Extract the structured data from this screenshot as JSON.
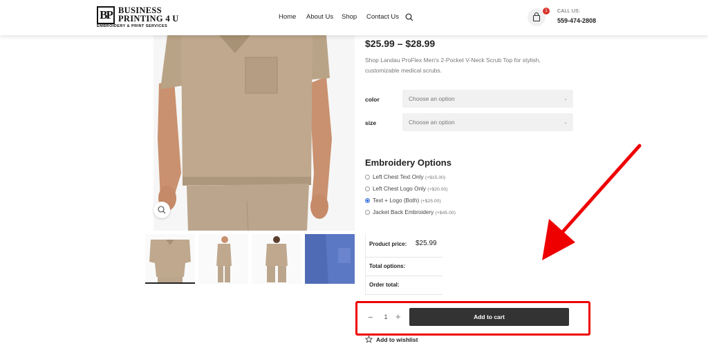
{
  "header": {
    "logo_mark": "BP",
    "logo_line1": "BUSINESS",
    "logo_line2": "PRINTING 4 U",
    "logo_tagline": "EMBROIDERY & PRINT SERVICES",
    "nav": [
      {
        "label": "Home"
      },
      {
        "label": "About Us"
      },
      {
        "label": "Shop"
      },
      {
        "label": "Contact Us"
      }
    ],
    "cart_count": "1",
    "call_label": "CALL US:",
    "call_number": "559-474-2808"
  },
  "product": {
    "price_range": "$25.99 – $28.99",
    "description": "Shop Landau ProFlex Men's 2-Pocket V-Neck Scrub Top for stylish, customizable medical scrubs.",
    "attributes": [
      {
        "label": "color",
        "selected": "Choose an option"
      },
      {
        "label": "size",
        "selected": "Choose an option"
      }
    ]
  },
  "embroidery": {
    "title": "Embroidery Options",
    "options": [
      {
        "label": "Left Chest Text Only",
        "price": "(+$15.00)",
        "checked": false
      },
      {
        "label": "Left Chest Logo Only",
        "price": "(+$20.00)",
        "checked": false
      },
      {
        "label": "Text + Logo (Both)",
        "price": "(+$25.00)",
        "checked": true
      },
      {
        "label": "Jacket Back Embroidery",
        "price": "(+$45.00)",
        "checked": false
      }
    ]
  },
  "summary": {
    "product_price_label": "Product price:",
    "product_price_value": "$25.99",
    "total_options_label": "Total options:",
    "order_total_label": "Order total:"
  },
  "cart": {
    "qty": "1",
    "minus": "−",
    "plus": "+",
    "add_to_cart": "Add to cart",
    "wishlist": "Add to wishlist"
  },
  "colors": {
    "accent_red": "#ee0000",
    "button_dark": "#333333",
    "radio_blue": "#2f6fd6",
    "scrub_tan": "#bfa88e",
    "scrub_blue": "#5b78c4"
  }
}
